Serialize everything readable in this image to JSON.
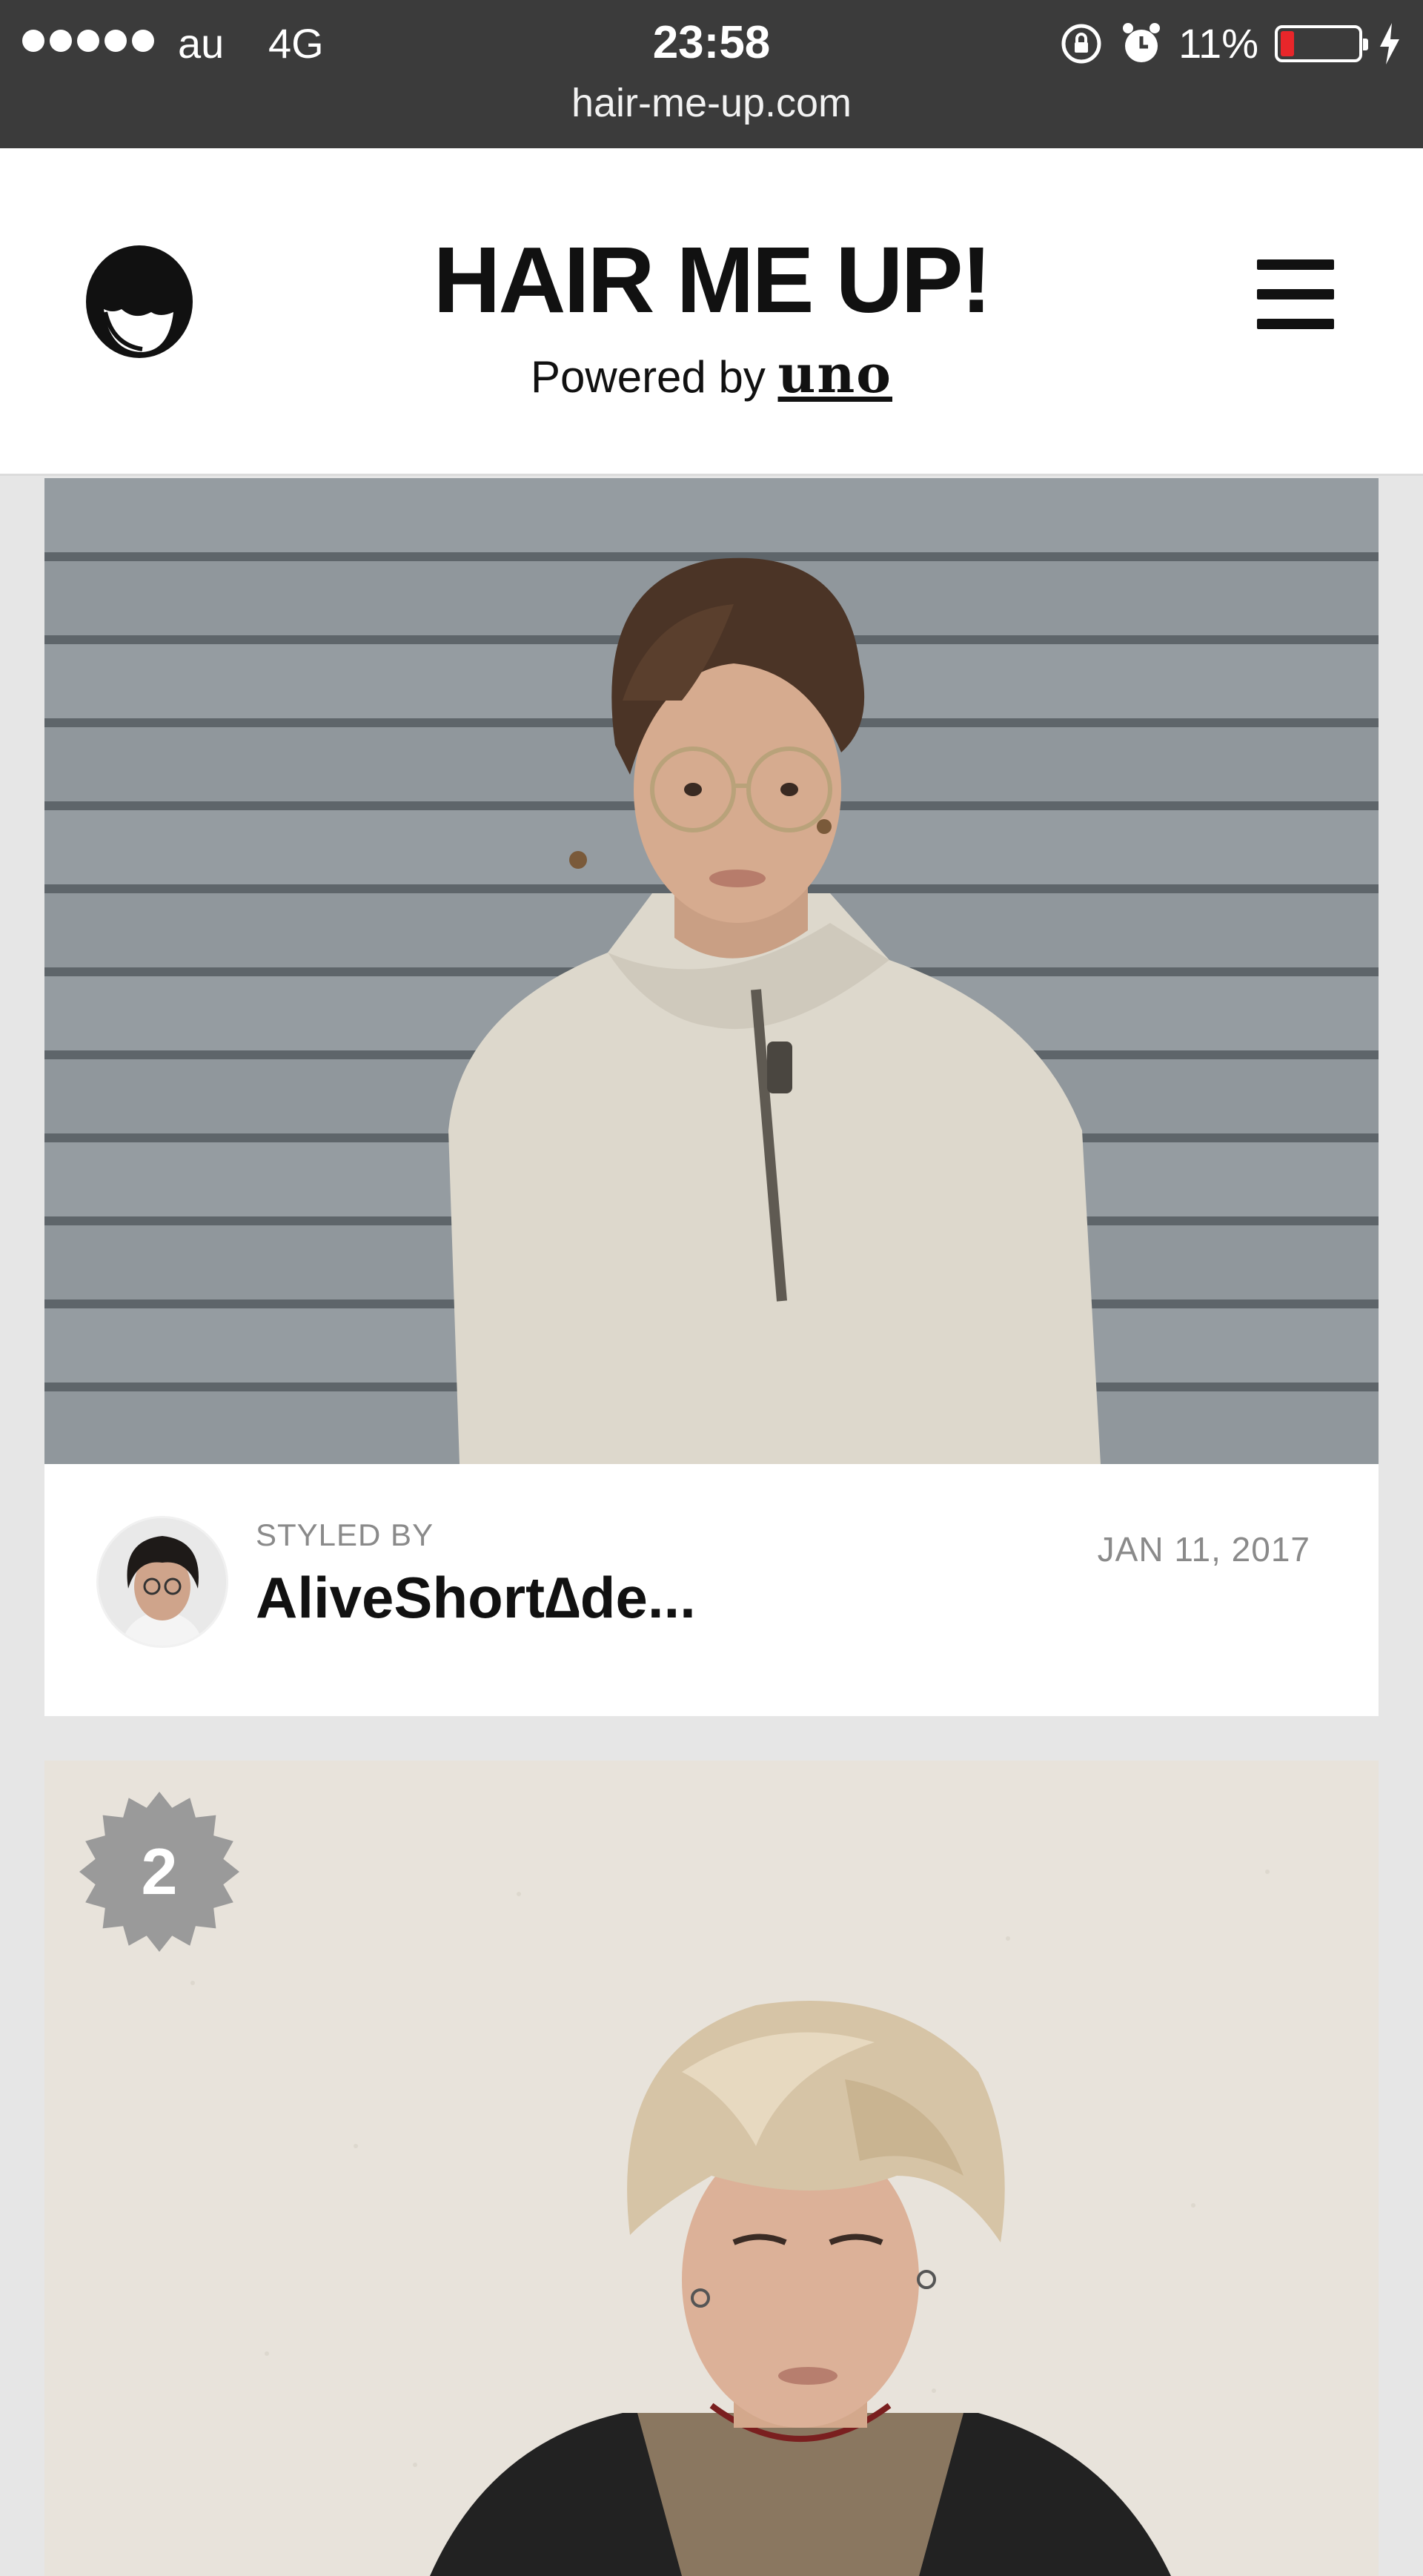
{
  "status_bar": {
    "carrier": "au",
    "network": "4G",
    "time": "23:58",
    "battery_percent": "11%",
    "battery_level": 0.11,
    "icons": [
      "signal-dots-icon",
      "rotation-lock-icon",
      "alarm-icon",
      "battery-icon",
      "charging-bolt-icon"
    ],
    "url": "hair-me-up.com"
  },
  "header": {
    "logo_icon": "hair-head-icon",
    "title": "HAIR ME UP!",
    "powered_by": "Powered by",
    "powered_brand": "uno",
    "menu_icon": "hamburger-menu-icon"
  },
  "cards": [
    {
      "styled_by_label": "STYLED BY",
      "stylist_name": "AliveShort∆de...",
      "date": "JAN 11, 2017"
    },
    {
      "rank": "2"
    }
  ],
  "colors": {
    "status_bar_bg": "#3b3b3b",
    "page_bg": "#e6e6e6",
    "battery_low": "#e8262a",
    "badge_bg": "#9a9a9a"
  }
}
